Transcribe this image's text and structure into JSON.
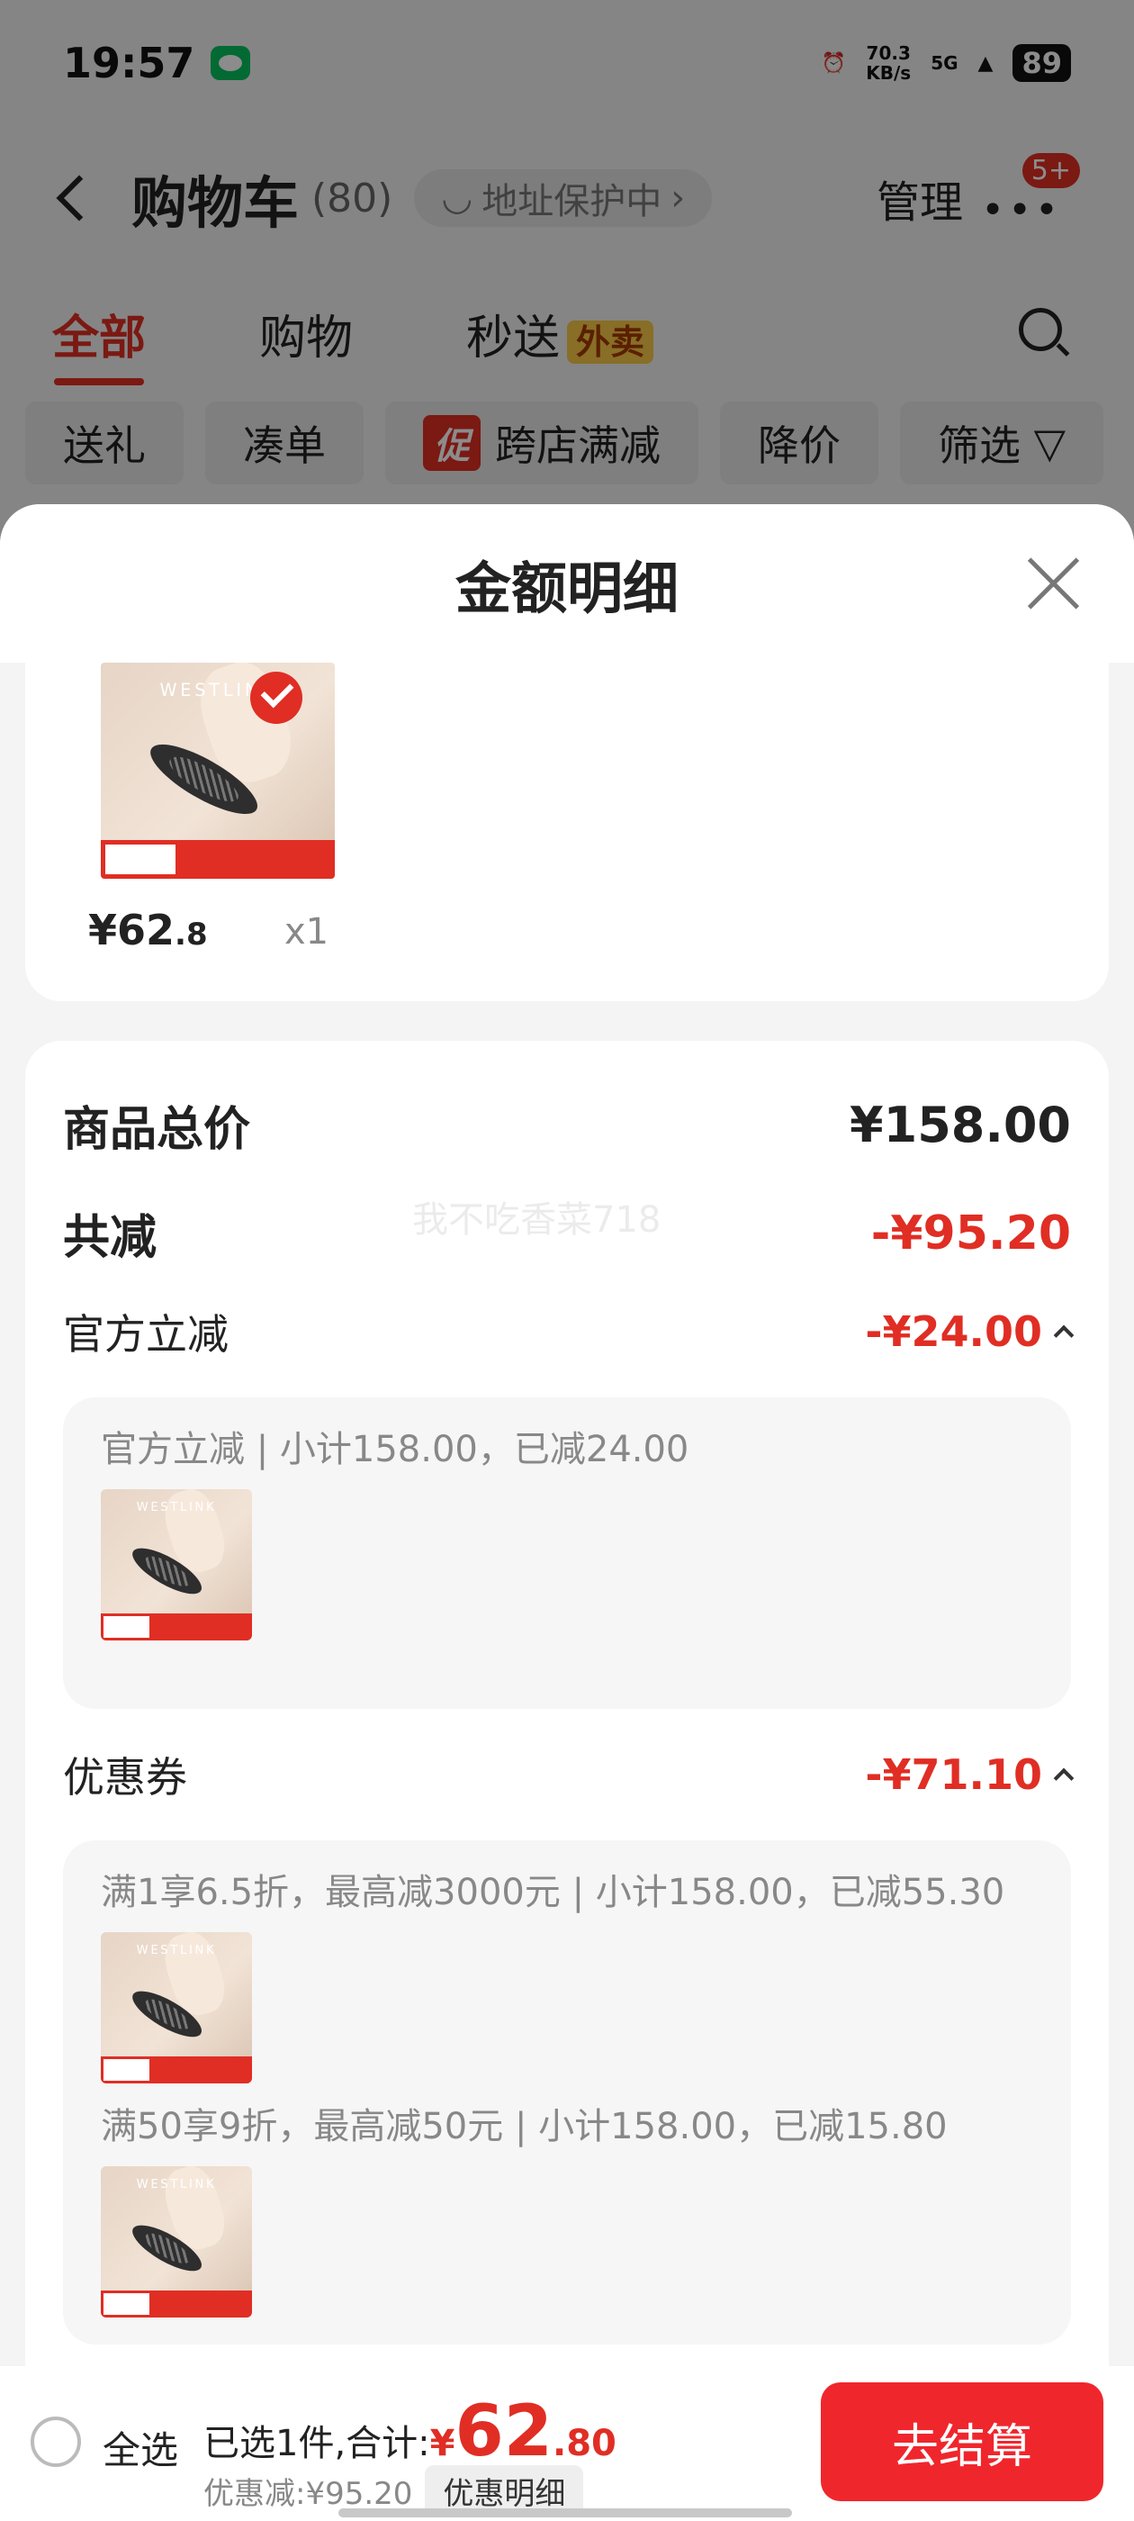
{
  "status": {
    "time": "19:57",
    "net_speed": "70.3",
    "net_unit": "KB/s",
    "signal": "5G",
    "battery": "89"
  },
  "nav": {
    "title": "购物车",
    "count": "(80)",
    "address_pill": "地址保护中",
    "manage": "管理",
    "more_badge": "5+"
  },
  "tabs": [
    {
      "label": "全部"
    },
    {
      "label": "购物"
    },
    {
      "label": "秒送"
    }
  ],
  "takeout_badge": "外卖",
  "filters": [
    {
      "label": "送礼"
    },
    {
      "label": "凑单"
    },
    {
      "label": "跨店满减"
    },
    {
      "label": "降价"
    },
    {
      "label": "筛选"
    }
  ],
  "promo_tag": "促",
  "sheet": {
    "title": "金额明细",
    "product": {
      "price_int": "¥62",
      "price_dec": ".8",
      "qty": "x1",
      "brand": "WESTLINK"
    },
    "watermark": "我不吃香菜718",
    "total": {
      "label": "商品总价",
      "amount": "¥158.00"
    },
    "reduce": {
      "label": "共减",
      "amount": "-¥95.20"
    },
    "official": {
      "label": "官方立减",
      "amount": "-¥24.00",
      "detail": "官方立减 | 小计158.00，已减24.00"
    },
    "coupon": {
      "label": "优惠券",
      "amount": "-¥71.10",
      "detail1": "满1享6.5折，最高减3000元 | 小计158.00，已减55.30",
      "detail2": "满50享9折，最高减50元 | 小计158.00，已减15.80"
    }
  },
  "bottom": {
    "select_all": "全选",
    "selected": "已选1件,合计:",
    "currency": "¥",
    "total_int": "62",
    "total_dec": ".80",
    "discount": "优惠减:¥95.20",
    "discount_btn": "优惠明细",
    "checkout": "去结算"
  },
  "colors": {
    "accent": "#e02e24",
    "checkout": "#f0262d"
  }
}
